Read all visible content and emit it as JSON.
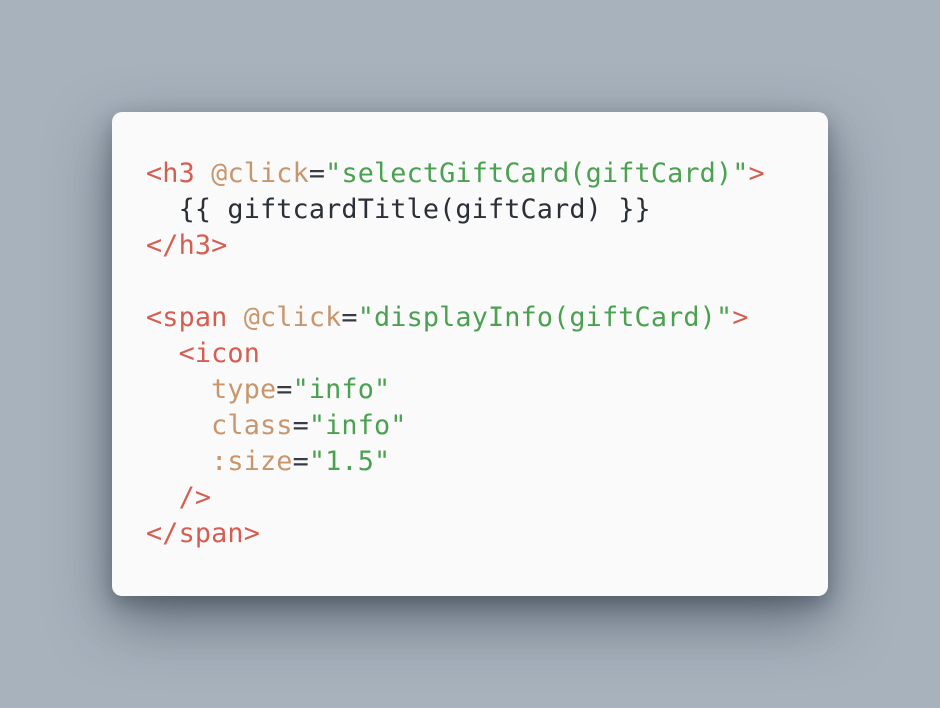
{
  "code": {
    "language": "vue-template",
    "lines": [
      {
        "tag_open": "<h3",
        "attr": "@click",
        "eq": "=",
        "value": "\"selectGiftCard(giftCard)\"",
        "tag_close": ">"
      },
      {
        "indent": "  ",
        "text": "{{ giftcardTitle(giftCard) }}"
      },
      {
        "tag": "</h3>"
      },
      {
        "blank": ""
      },
      {
        "tag_open": "<span",
        "attr": "@click",
        "eq": "=",
        "value": "\"displayInfo(giftCard)\"",
        "tag_close": ">"
      },
      {
        "indent": "  ",
        "tag": "<icon"
      },
      {
        "indent": "    ",
        "attr": "type",
        "eq": "=",
        "value": "\"info\""
      },
      {
        "indent": "    ",
        "attr": "class",
        "eq": "=",
        "value": "\"info\""
      },
      {
        "indent": "    ",
        "attr": ":size",
        "eq": "=",
        "value": "\"1.5\""
      },
      {
        "indent": "  ",
        "tag": "/>"
      },
      {
        "tag": "</span>"
      }
    ]
  },
  "colors": {
    "background": "#a7b2bd",
    "card": "#fafafa",
    "tag": "#d45e51",
    "attribute": "#c8966c",
    "string": "#4aa150",
    "text": "#2b2f36"
  }
}
